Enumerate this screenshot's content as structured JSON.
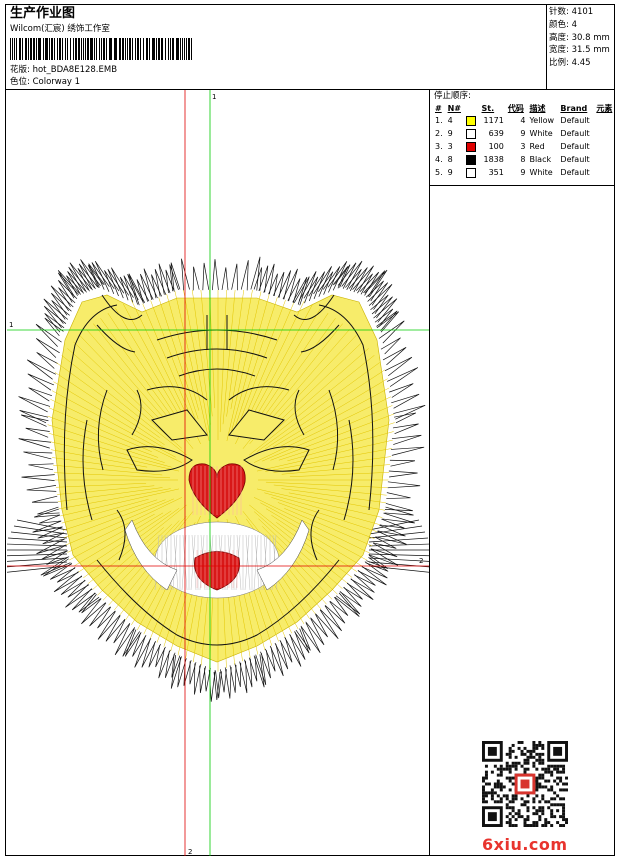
{
  "sheet": {
    "title": "生产作业图",
    "studio": "Wilcom(汇宸) 绣饰工作室",
    "design_label": "花版:",
    "design_file": "hot_BDA8E128.EMB",
    "colorway_label": "色位:",
    "colorway": "Colorway 1"
  },
  "specs": [
    {
      "label": "针数:",
      "value": "4101"
    },
    {
      "label": "颜色:",
      "value": "4"
    },
    {
      "label": "高度:",
      "value": "30.8 mm"
    },
    {
      "label": "宽度:",
      "value": "31.5 mm"
    },
    {
      "label": "比例:",
      "value": "4.45"
    }
  ],
  "stop_sequence": {
    "title": "停止顺序:",
    "headers": [
      "#",
      "N#",
      "St.",
      "代码",
      "描述",
      "Brand",
      "元素"
    ],
    "rows": [
      {
        "order": "1.",
        "needle": "4",
        "swatch": "#ffff00",
        "stitches": "1171",
        "code": "4",
        "desc": "Yellow",
        "brand": "Default"
      },
      {
        "order": "2.",
        "needle": "9",
        "swatch": "#ffffff",
        "stitches": "639",
        "code": "9",
        "desc": "White",
        "brand": "Default"
      },
      {
        "order": "3.",
        "needle": "3",
        "swatch": "#e00000",
        "stitches": "100",
        "code": "3",
        "desc": "Red",
        "brand": "Default"
      },
      {
        "order": "4.",
        "needle": "8",
        "swatch": "#000000",
        "stitches": "1838",
        "code": "8",
        "desc": "Black",
        "brand": "Default"
      },
      {
        "order": "5.",
        "needle": "9",
        "swatch": "#ffffff",
        "stitches": "351",
        "code": "9",
        "desc": "White",
        "brand": "Default"
      }
    ]
  },
  "guides": {
    "vertical_1": "1",
    "vertical_2": "2",
    "horizontal_1": "1",
    "horizontal_2": "2",
    "green": "#00cc00",
    "red": "#e00000"
  },
  "colors": {
    "yellow_thread": "#f5e84a",
    "red_thread": "#d81818",
    "black_thread": "#111111"
  },
  "watermark": {
    "site": "6xiu.com"
  }
}
